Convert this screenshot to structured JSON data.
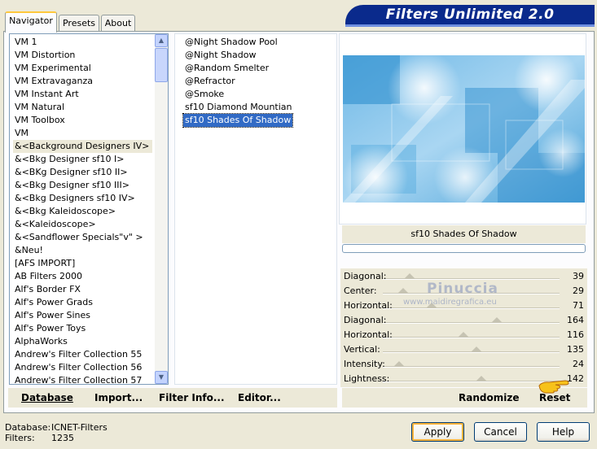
{
  "tabs": [
    "Navigator",
    "Presets",
    "About"
  ],
  "banner_title": "Filters Unlimited 2.0",
  "categories": [
    "VM 1",
    "VM Distortion",
    "VM Experimental",
    "VM Extravaganza",
    "VM Instant Art",
    "VM Natural",
    "VM Toolbox",
    "VM",
    "&<Background Designers IV>",
    "&<Bkg Designer sf10 I>",
    "&<BKg Designer sf10 II>",
    "&<Bkg Designer sf10 III>",
    "&<Bkg Designers sf10 IV>",
    "&<Bkg Kaleidoscope>",
    "&<Kaleidoscope>",
    "&<Sandflower Specials\"v\" >",
    "&Neu!",
    "[AFS IMPORT]",
    "AB Filters 2000",
    "Alf's Border FX",
    "Alf's Power Grads",
    "Alf's Power Sines",
    "Alf's Power Toys",
    "AlphaWorks",
    "Andrew's Filter Collection 55",
    "Andrew's Filter Collection 56",
    "Andrew's Filter Collection 57"
  ],
  "filters": [
    "@Night Shadow Pool",
    "@Night Shadow",
    "@Random Smelter",
    "@Refractor",
    "@Smoke",
    "sf10 Diamond Mountian",
    "sf10 Shades Of Shadow"
  ],
  "selected_filter_name": "sf10 Shades Of Shadow",
  "sliders": [
    {
      "label": "Diagonal:",
      "value": "39"
    },
    {
      "label": "Center:",
      "value": "29"
    },
    {
      "label": "Horizontal:",
      "value": "71"
    },
    {
      "label": "Diagonal:",
      "value": "164"
    },
    {
      "label": "Horizontal:",
      "value": "116"
    },
    {
      "label": "Vertical:",
      "value": "135"
    },
    {
      "label": "Intensity:",
      "value": "24"
    },
    {
      "label": "Lightness:",
      "value": "142"
    }
  ],
  "watermark": {
    "line1": "Pinuccia",
    "line2": "www.maidiregrafica.eu"
  },
  "bottom_left": {
    "database": "Database",
    "import": "Import...",
    "filter_info": "Filter Info...",
    "editor": "Editor..."
  },
  "bottom_right": {
    "randomize": "Randomize",
    "reset": "Reset"
  },
  "footer": {
    "database_label": "Database:",
    "database_value": "ICNET-Filters",
    "filters_label": "Filters:",
    "filters_value": "1235"
  },
  "buttons": {
    "apply": "Apply",
    "cancel": "Cancel",
    "help": "Help"
  }
}
